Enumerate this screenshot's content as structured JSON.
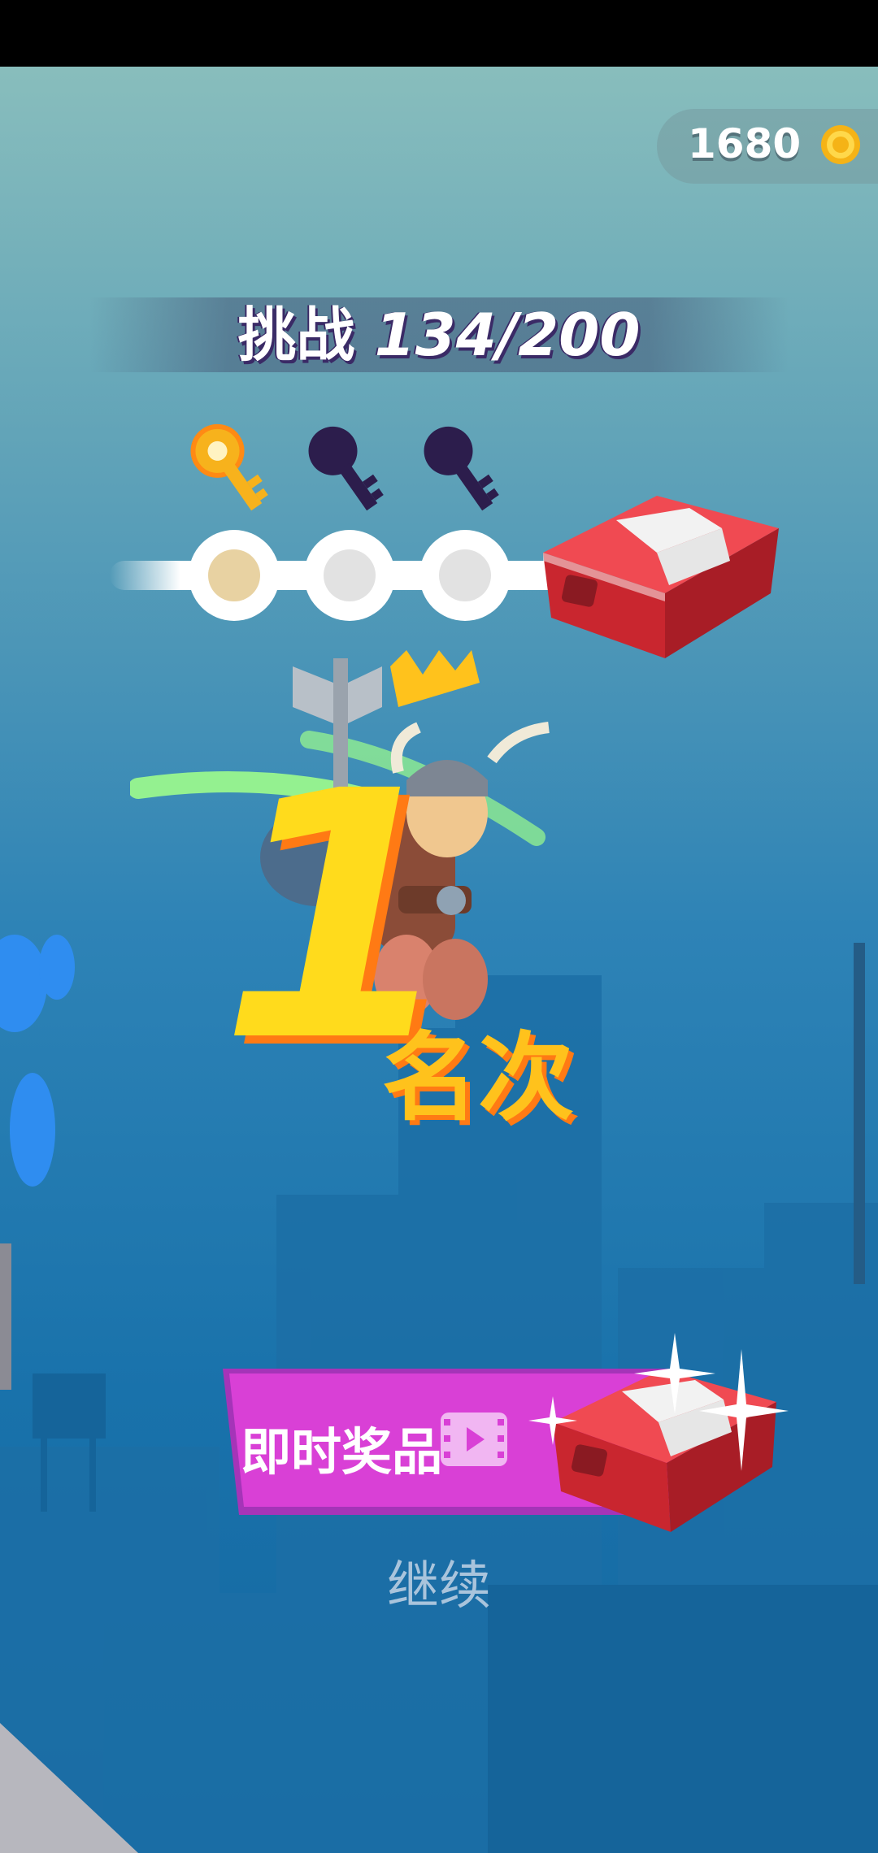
{
  "hud": {
    "coins": "1680",
    "coin_icon": "coin-icon"
  },
  "challenge": {
    "label": "挑战",
    "progress": "134/200"
  },
  "keys": {
    "collected": 1,
    "total": 3
  },
  "rank": {
    "number": "1",
    "suffix": "名次"
  },
  "reward_button": {
    "label": "即时奖品",
    "icon": "video-icon"
  },
  "continue_label": "继续",
  "colors": {
    "rank_yellow": "#ffdb1c",
    "rank_orange": "#ff7a14",
    "reward_magenta": "#d940d6",
    "chest_red": "#e8323a"
  }
}
